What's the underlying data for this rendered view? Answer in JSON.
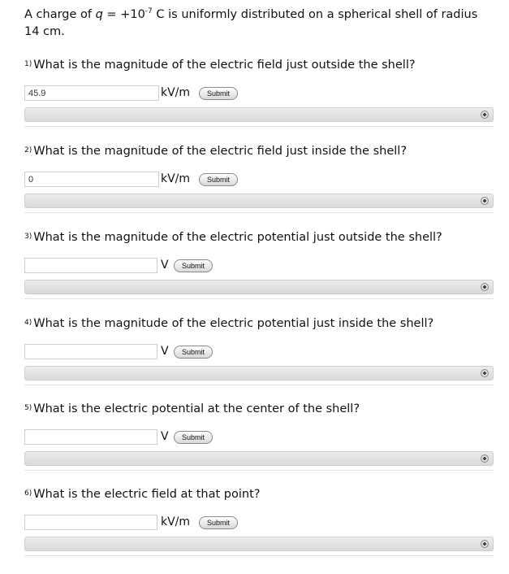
{
  "problem": {
    "text_before_q": "A charge of ",
    "q_symbol": "q",
    "text_after_q": " = +10",
    "exponent": "-7",
    "text_after_exponent": " C is uniformly distributed on a spherical shell of radius 14 cm."
  },
  "questions": [
    {
      "number": "1)",
      "text": "What is the magnitude of the electric field just outside the shell?",
      "value": "45.9",
      "unit": "kV/m",
      "submit": "Submit"
    },
    {
      "number": "2)",
      "text": "What is the magnitude of the electric field just inside the shell?",
      "value": "0",
      "unit": "kV/m",
      "submit": "Submit"
    },
    {
      "number": "3)",
      "text": "What is the magnitude of the electric potential just outside the shell?",
      "value": "",
      "unit": "V",
      "submit": "Submit"
    },
    {
      "number": "4)",
      "text": "What is the magnitude of the electric potential just inside the shell?",
      "value": "",
      "unit": "V",
      "submit": "Submit"
    },
    {
      "number": "5)",
      "text": "What is the electric potential at the center of the shell?",
      "value": "",
      "unit": "V",
      "submit": "Submit"
    },
    {
      "number": "6)",
      "text": "What is the electric field at that point?",
      "value": "",
      "unit": "kV/m",
      "submit": "Submit"
    }
  ]
}
